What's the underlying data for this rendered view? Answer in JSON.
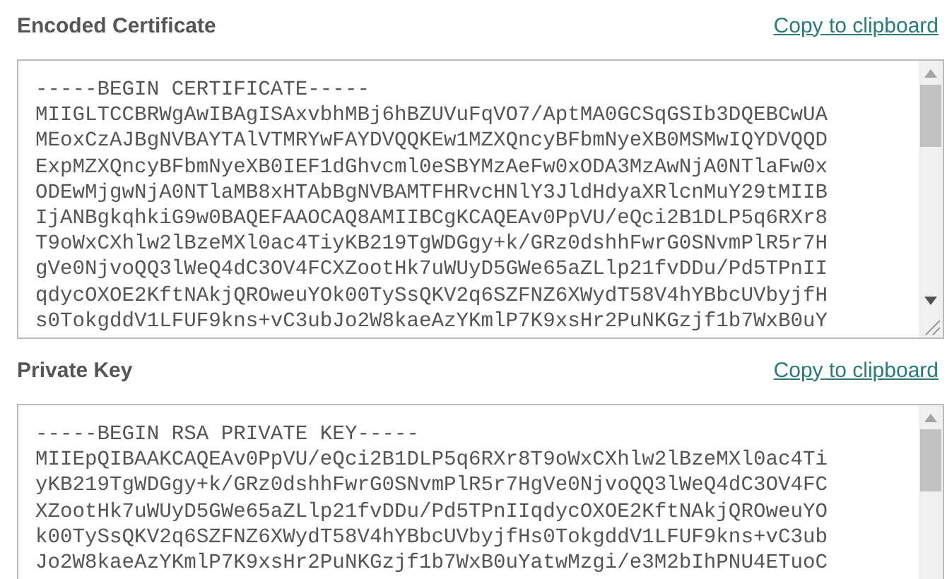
{
  "sections": [
    {
      "title": "Encoded Certificate",
      "link": "Copy to clipboard",
      "lines": [
        "-----BEGIN CERTIFICATE-----",
        "MIIGLTCCBRWgAwIBAgISAxvbhMBj6hBZUVuFqVO7/AptMA0GCSqGSIb3DQEBCwUA",
        "MEoxCzAJBgNVBAYTAlVTMRYwFAYDVQQKEw1MZXQncyBFbmNyeXB0MSMwIQYDVQQD",
        "ExpMZXQncyBFbmNyeXB0IEF1dGhvcml0eSBYMzAeFw0xODA3MzAwNjA0NTlaFw0x",
        "ODEwMjgwNjA0NTlaMB8xHTAbBgNVBAMTFHRvcHNlY3JldHdyaXRlcnMuY29tMIIB",
        "IjANBgkqhkiG9w0BAQEFAAOCAQ8AMIIBCgKCAQEAv0PpVU/eQci2B1DLP5q6RXr8",
        "T9oWxCXhlw2lBzeMXl0ac4TiyKB219TgWDGgy+k/GRz0dshhFwrG0SNvmPlR5r7H",
        "gVe0NjvoQQ3lWeQ4dC3OV4FCXZootHk7uWUyD5GWe65aZLlp21fvDDu/Pd5TPnII",
        "qdycOXOE2KftNAkjQROweuYOk00TySsQKV2q6SZFNZ6XWydT58V4hYBbcUVbyjfH",
        "s0TokgddV1LFUF9kns+vC3ubJo2W8kaeAzYKmlP7K9xsHr2PuNKGzjf1b7WxB0uY"
      ]
    },
    {
      "title": "Private Key",
      "link": "Copy to clipboard",
      "lines": [
        "-----BEGIN RSA PRIVATE KEY-----",
        "MIIEpQIBAAKCAQEAv0PpVU/eQci2B1DLP5q6RXr8T9oWxCXhlw2lBzeMXl0ac4Ti",
        "yKB219TgWDGgy+k/GRz0dshhFwrG0SNvmPlR5r7HgVe0NjvoQQ3lWeQ4dC3OV4FC",
        "XZootHk7uWUyD5GWe65aZLlp21fvDDu/Pd5TPnIIqdycOXOE2KftNAkjQROweuYO",
        "k00TySsQKV2q6SZFNZ6XWydT58V4hYBbcUVbyjfHs0TokgddV1LFUF9kns+vC3ub",
        "Jo2W8kaeAzYKmlP7K9xsHr2PuNKGzjf1b7WxB0uYatwMzgi/e3M2bIhPNU4ETuoC"
      ]
    }
  ]
}
